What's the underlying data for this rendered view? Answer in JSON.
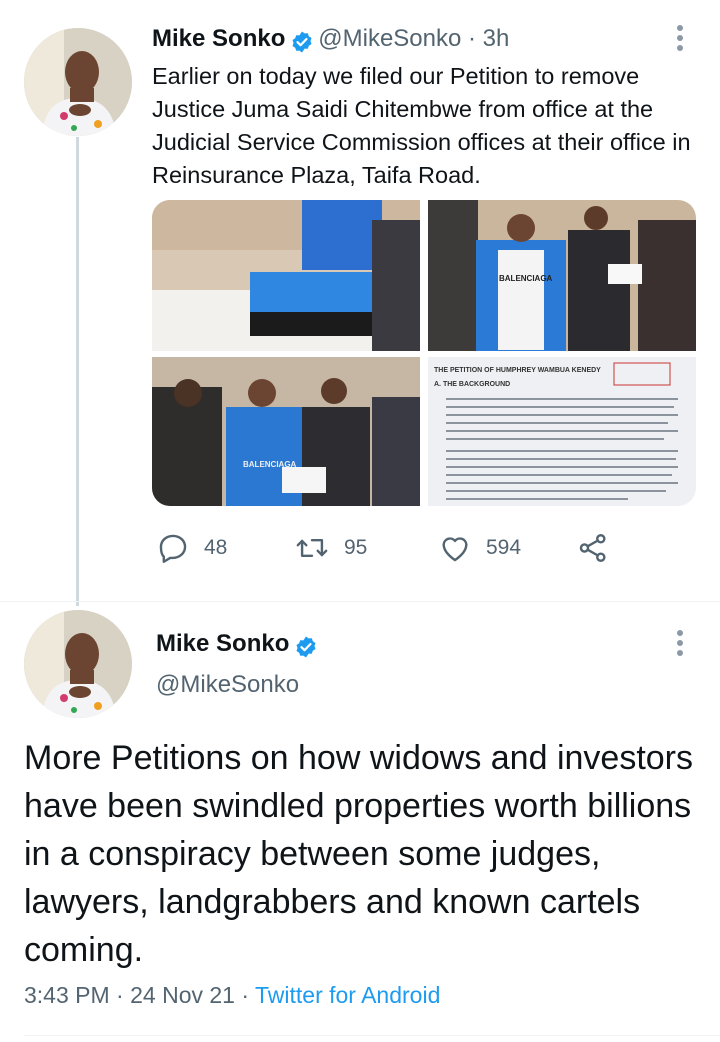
{
  "tweet1": {
    "author_name": "Mike Sonko",
    "handle_time": "@MikeSonko · 3h",
    "text": "Earlier on today we filed our Petition to remove Justice Juma Saidi Chitembwe from office at the Judicial Service Commission offices at their office in Reinsurance Plaza, Taifa Road.",
    "reply_count": "48",
    "retweet_count": "95",
    "like_count": "594",
    "media": [
      {
        "description": "office-box-photo"
      },
      {
        "description": "group-standing-photo",
        "text": "BALENCIAGA"
      },
      {
        "description": "group-seated-photo",
        "text": "BALENCIAGA"
      },
      {
        "description": "petition-document-photo",
        "heading": "THE PETITION OF HUMPHREY WAMBUA KENEDY",
        "section": "A. THE BACKGROUND"
      }
    ]
  },
  "tweet2": {
    "author_name": "Mike Sonko",
    "handle": "@MikeSonko",
    "text": "More Petitions on how  widows and investors have been swindled properties worth billions  in a conspiracy between some judges, lawyers, landgrabbers and known cartels coming.",
    "time": "3:43 PM",
    "date": "24 Nov 21",
    "source": "Twitter for Android"
  },
  "icons": [
    "verified-badge-icon",
    "more-options-icon",
    "reply-icon",
    "retweet-icon",
    "like-icon",
    "share-icon"
  ],
  "colors": {
    "accent": "#1d9bf0",
    "text": "#0f1419",
    "secondary": "#536471",
    "thread_line": "#cfd9de"
  }
}
